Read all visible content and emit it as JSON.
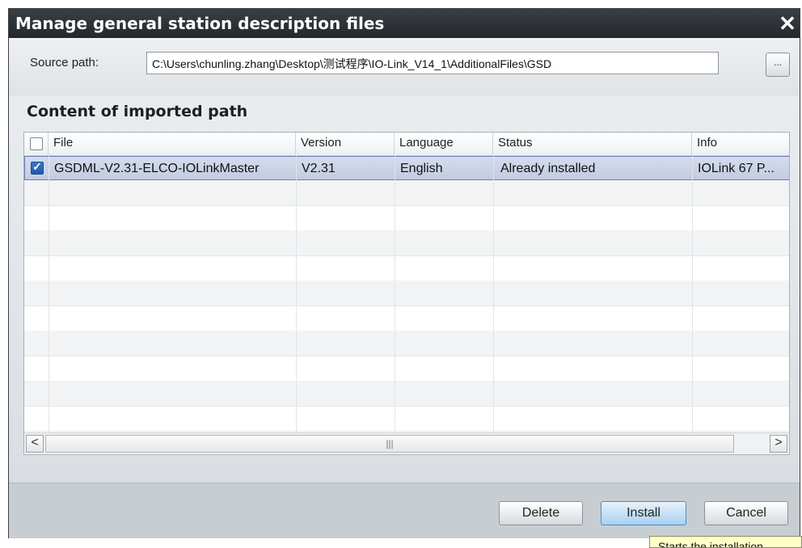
{
  "window": {
    "title": "Manage general station description files",
    "close_glyph": "✕"
  },
  "source": {
    "label": "Source path:",
    "value": "C:\\Users\\chunling.zhang\\Desktop\\测试程序\\IO-Link_V14_1\\AdditionalFiles\\GSD",
    "browse_label": "..."
  },
  "content": {
    "heading": "Content of imported path",
    "columns": [
      "File",
      "Version",
      "Language",
      "Status",
      "Info"
    ],
    "rows": [
      {
        "checked": true,
        "file": "GSDML-V2.31-ELCO-IOLinkMaster",
        "version": "V2.31",
        "language": "English",
        "status": "Already installed",
        "info": "IOLink 67 P..."
      }
    ]
  },
  "scrollbar": {
    "left_glyph": "<",
    "right_glyph": ">",
    "thumb_grip": "|||"
  },
  "buttons": {
    "delete": "Delete",
    "install": "Install",
    "cancel": "Cancel"
  },
  "tooltip": {
    "text": "Starts the installation"
  },
  "colors": {
    "titlebar": "#2b2f34",
    "selection": "#c8d0e6",
    "checkbox_checked": "#2a67b7",
    "primary_button": "#a9d1f1",
    "tooltip_bg": "#ffffc8"
  }
}
